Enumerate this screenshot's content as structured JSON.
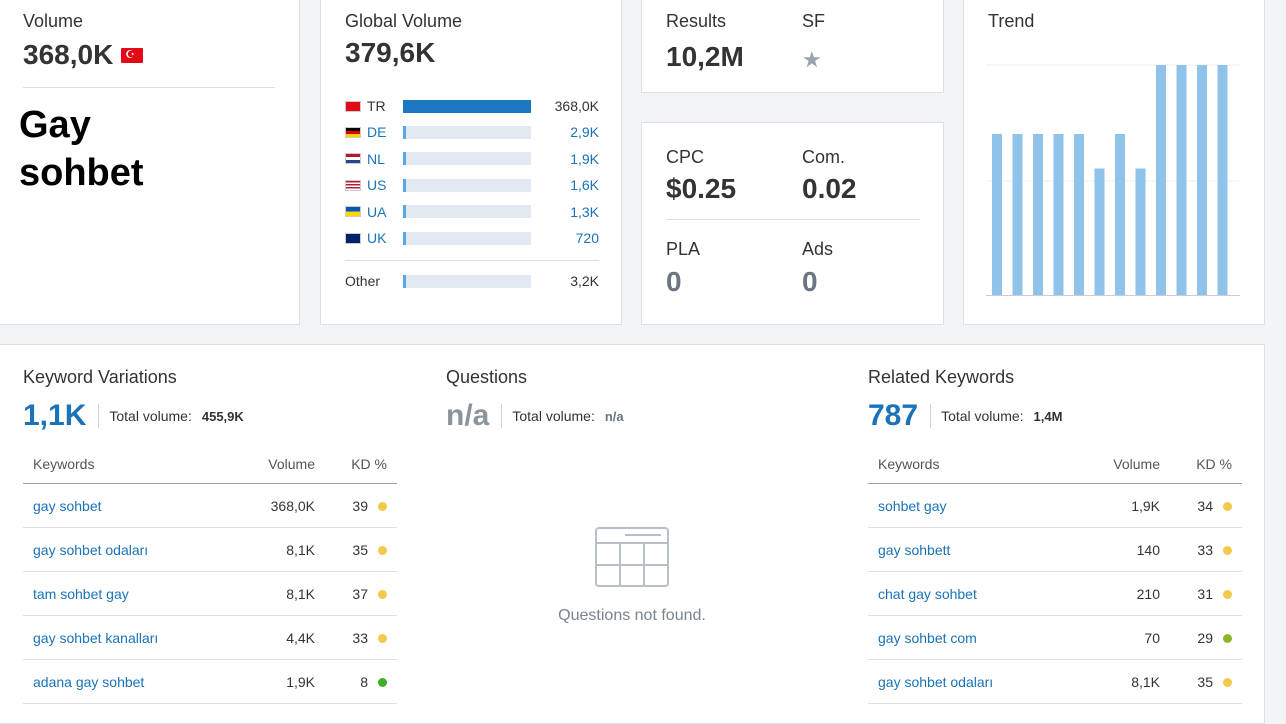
{
  "volume": {
    "label": "Volume",
    "value": "368,0K",
    "flag_icon": "flag-turkey-icon",
    "keyword": "Gay sohbet"
  },
  "global_volume": {
    "label": "Global Volume",
    "value": "379,6K",
    "countries": [
      {
        "code": "TR",
        "value": "368,0K",
        "share": 1.0
      },
      {
        "code": "DE",
        "value": "2,9K",
        "share": 0.02
      },
      {
        "code": "NL",
        "value": "1,9K",
        "share": 0.015
      },
      {
        "code": "US",
        "value": "1,6K",
        "share": 0.015
      },
      {
        "code": "UA",
        "value": "1,3K",
        "share": 0.012
      },
      {
        "code": "UK",
        "value": "720",
        "share": 0.01
      }
    ],
    "other": {
      "label": "Other",
      "value": "3,2K",
      "share": 0.02
    }
  },
  "results": {
    "label": "Results",
    "value": "10,2M",
    "sf_label": "SF",
    "sf_icon": "star-icon"
  },
  "cpc": {
    "cpc_label": "CPC",
    "cpc_value": "$0.25",
    "com_label": "Com.",
    "com_value": "0.02",
    "pla_label": "PLA",
    "pla_value": "0",
    "ads_label": "Ads",
    "ads_value": "0"
  },
  "trend": {
    "label": "Trend",
    "chart_data": {
      "type": "bar",
      "values": [
        0.7,
        0.7,
        0.7,
        0.7,
        0.7,
        0.55,
        0.7,
        0.55,
        1.0,
        1.0,
        1.0,
        1.0
      ],
      "ylim": [
        0,
        1
      ],
      "color": "#8fc3ea"
    }
  },
  "keyword_variations": {
    "title": "Keyword Variations",
    "count": "1,1K",
    "total_volume_label": "Total volume:",
    "total_volume": "455,9K",
    "columns": [
      "Keywords",
      "Volume",
      "KD %"
    ],
    "rows": [
      {
        "keyword": "gay sohbet",
        "volume": "368,0K",
        "kd": "39",
        "color": "#f2c94c"
      },
      {
        "keyword": "gay sohbet odaları",
        "volume": "8,1K",
        "kd": "35",
        "color": "#f2c94c"
      },
      {
        "keyword": "tam sohbet gay",
        "volume": "8,1K",
        "kd": "37",
        "color": "#f2c94c"
      },
      {
        "keyword": "gay sohbet kanalları",
        "volume": "4,4K",
        "kd": "33",
        "color": "#f2c94c"
      },
      {
        "keyword": "adana gay sohbet",
        "volume": "1,9K",
        "kd": "8",
        "color": "#3fae29"
      }
    ]
  },
  "questions": {
    "title": "Questions",
    "count": "n/a",
    "total_volume_label": "Total volume:",
    "total_volume": "n/a",
    "empty_text": "Questions not found.",
    "empty_icon": "empty-table-icon"
  },
  "related_keywords": {
    "title": "Related Keywords",
    "count": "787",
    "total_volume_label": "Total volume:",
    "total_volume": "1,4M",
    "columns": [
      "Keywords",
      "Volume",
      "KD %"
    ],
    "rows": [
      {
        "keyword": "sohbet gay",
        "volume": "1,9K",
        "kd": "34",
        "color": "#f2c94c"
      },
      {
        "keyword": "gay sohbett",
        "volume": "140",
        "kd": "33",
        "color": "#f2c94c"
      },
      {
        "keyword": "chat gay sohbet",
        "volume": "210",
        "kd": "31",
        "color": "#f2c94c"
      },
      {
        "keyword": "gay sohbet com",
        "volume": "70",
        "kd": "29",
        "color": "#8bb52a"
      },
      {
        "keyword": "gay sohbet odaları",
        "volume": "8,1K",
        "kd": "35",
        "color": "#f2c94c"
      }
    ]
  }
}
